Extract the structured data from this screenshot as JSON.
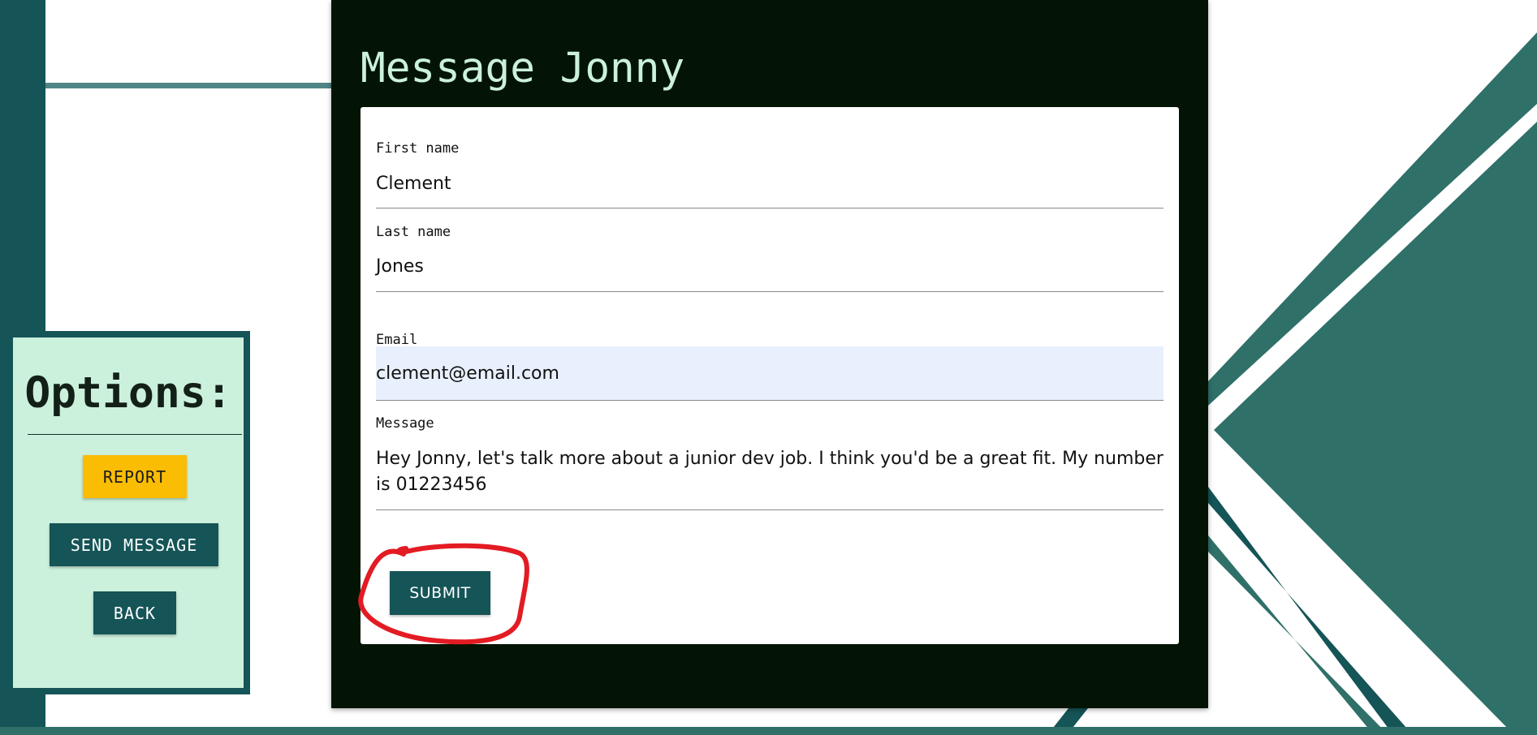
{
  "colors": {
    "teal_dark": "#155457",
    "teal_medium": "#2f7068",
    "mint_background": "#cbf1dc",
    "panel_dark": "#031404",
    "report_yellow": "#fbbd04",
    "annotation_red": "#e31b23"
  },
  "options": {
    "title": "Options:",
    "report_label": "REPORT",
    "send_message_label": "SEND MESSAGE",
    "back_label": "BACK"
  },
  "message_form": {
    "title": "Message Jonny",
    "fields": {
      "first_name": {
        "label": "First name",
        "value": "Clement"
      },
      "last_name": {
        "label": "Last name",
        "value": "Jones"
      },
      "email": {
        "label": "Email",
        "value": "clement@email.com"
      },
      "message": {
        "label": "Message",
        "value": "Hey Jonny, let's talk more about a junior dev job. I think you'd be a great fit. My number is 01223456"
      }
    },
    "submit_label": "SUBMIT"
  },
  "annotation": {
    "target": "submit-button",
    "shape": "hand-drawn circle"
  }
}
